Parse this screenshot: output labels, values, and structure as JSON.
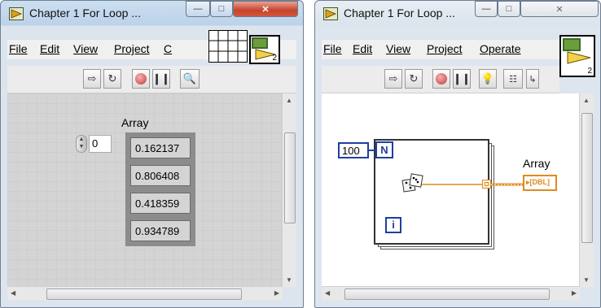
{
  "front_panel": {
    "title": "Chapter 1 For Loop ...",
    "menu": [
      "File",
      "Edit",
      "View",
      "Project",
      "C"
    ],
    "array_label": "Array",
    "index_value": "0",
    "array_values": [
      "0.162137",
      "0.806408",
      "0.418359",
      "0.934789"
    ],
    "connector_pane_number": "2"
  },
  "block_diagram": {
    "title": "Chapter 1 For Loop ...",
    "menu": [
      "File",
      "Edit",
      "View",
      "Project",
      "Operate"
    ],
    "count_constant": "100",
    "count_terminal": "N",
    "iteration_terminal": "i",
    "array_label": "Array",
    "indicator_type": "DBL",
    "connector_pane_number": "2"
  },
  "colors": {
    "loop_terminal_blue": "#1f3f9f",
    "wire_orange": "#e08a1e",
    "close_red": "#c7432b"
  }
}
